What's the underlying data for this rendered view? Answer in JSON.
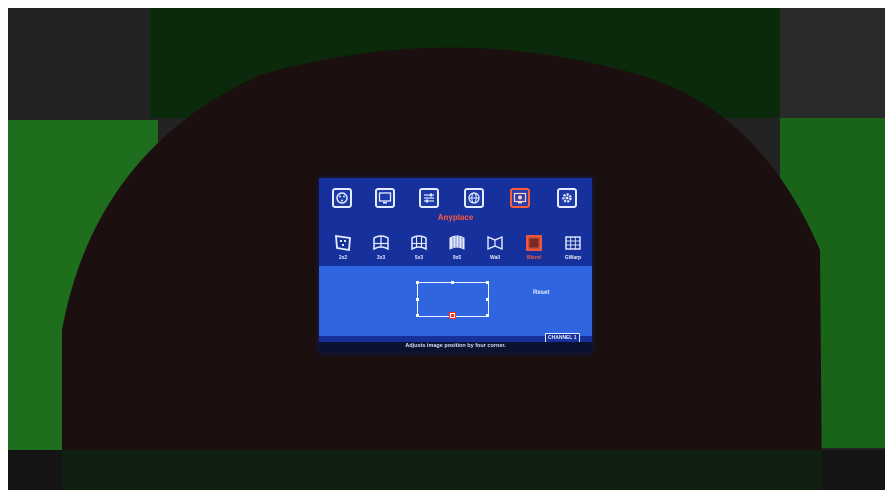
{
  "osd": {
    "top_icons": [
      {
        "name": "color-icon",
        "active": false
      },
      {
        "name": "display-icon",
        "active": false
      },
      {
        "name": "settings-slider-icon",
        "active": false
      },
      {
        "name": "globe-icon",
        "active": false
      },
      {
        "name": "anyplace-icon",
        "active": true
      },
      {
        "name": "gear-icon",
        "active": false
      }
    ],
    "menu_title": "Anyplace",
    "sub_items": [
      {
        "label": "2x2",
        "icon": "quad-warp-icon"
      },
      {
        "label": "3x3",
        "icon": "grid-3x3-icon"
      },
      {
        "label": "5x3",
        "icon": "grid-5x3-icon"
      },
      {
        "label": "9x5",
        "icon": "grid-9x5-icon"
      },
      {
        "label": "Wall",
        "icon": "wall-icon"
      },
      {
        "label": "Blend",
        "icon": "blend-icon"
      },
      {
        "label": "GWarp",
        "icon": "gwarp-icon"
      }
    ],
    "selected_sub_item": "Blend",
    "reset_label": "Reset",
    "channel_label": "CHANNEL 1",
    "status_text": "Adjusts image position by four corner.",
    "colors": {
      "osd_background": "#17319c",
      "panel_background": "#2f66e0",
      "highlight": "#ff5a3a",
      "wall_green": "#1f7a1f",
      "wall_dark": "#1b0f0f"
    }
  }
}
